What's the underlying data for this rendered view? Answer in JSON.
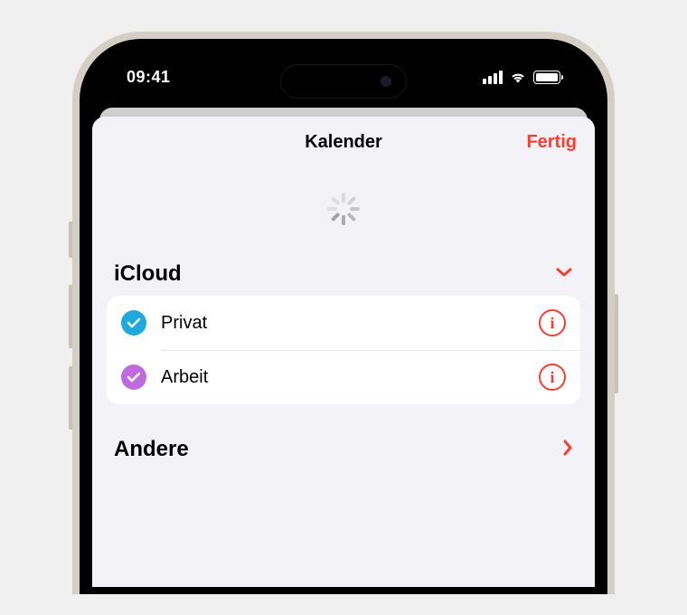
{
  "status": {
    "time": "09:41"
  },
  "sheet": {
    "title": "Kalender",
    "done_label": "Fertig"
  },
  "sections": {
    "icloud": {
      "title": "iCloud",
      "calendars": [
        {
          "label": "Privat",
          "color": "#1ca9dd"
        },
        {
          "label": "Arbeit",
          "color": "#c06ae0"
        }
      ]
    },
    "other": {
      "title": "Andere"
    }
  },
  "colors": {
    "accent": "#ff3b30"
  }
}
